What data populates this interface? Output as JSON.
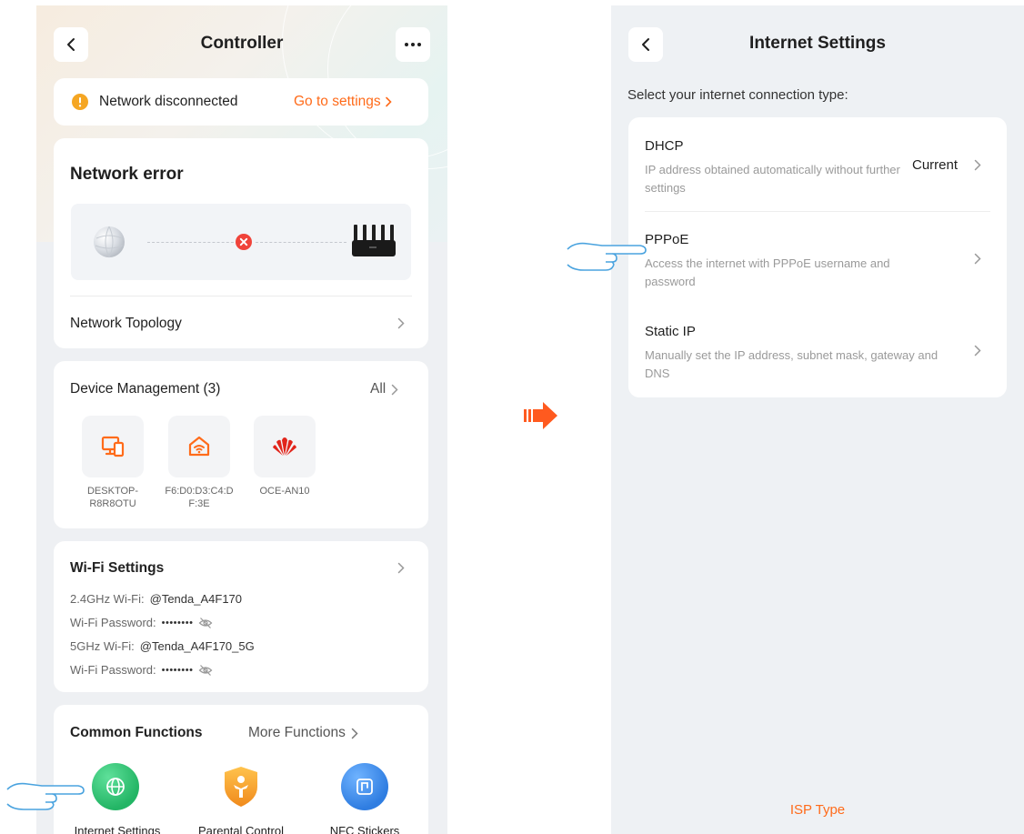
{
  "controller": {
    "title": "Controller",
    "banner": {
      "text": "Network disconnected",
      "link": "Go to settings"
    },
    "network_error": {
      "title": "Network error",
      "topology_label": "Network Topology"
    },
    "device_management": {
      "title": "Device Management (3)",
      "all_label": "All",
      "devices": [
        {
          "label": "DESKTOP-\nR8R8OTU",
          "icon": "computer-icon"
        },
        {
          "label": "F6:D0:D3:C4:D\nF:3E",
          "icon": "smart-home-wifi-icon"
        },
        {
          "label": "OCE-AN10",
          "icon": "huawei-logo"
        }
      ]
    },
    "wifi_settings": {
      "title": "Wi-Fi Settings",
      "rows": [
        {
          "label": "2.4GHz Wi-Fi:",
          "value": "@Tenda_A4F170"
        },
        {
          "label": "Wi-Fi Password:",
          "value": "••••••••"
        },
        {
          "label": "5GHz Wi-Fi:",
          "value": "@Tenda_A4F170_5G"
        },
        {
          "label": "Wi-Fi Password:",
          "value": "••••••••"
        }
      ]
    },
    "common_functions": {
      "title": "Common Functions",
      "more_label": "More Functions",
      "items": [
        {
          "label": "Internet Settings",
          "icon": "globe-icon",
          "color": "#2fbf71"
        },
        {
          "label": "Parental Control",
          "icon": "child-shield-icon",
          "color": "#f5a623"
        },
        {
          "label": "NFC Stickers",
          "icon": "nfc-icon",
          "color": "#2f7de1"
        }
      ]
    }
  },
  "internet_settings": {
    "title": "Internet Settings",
    "prompt": "Select your internet connection type:",
    "options": [
      {
        "title": "DHCP",
        "desc": "IP address obtained automatically without further settings",
        "status": "Current"
      },
      {
        "title": "PPPoE",
        "desc": "Access the internet with PPPoE username and password",
        "status": ""
      },
      {
        "title": "Static IP",
        "desc": "Manually set the IP address, subnet mask, gateway and DNS",
        "status": ""
      }
    ],
    "footer_link": "ISP Type"
  },
  "colors": {
    "accent": "#ff6b1a",
    "error": "#f0433a",
    "warning": "#f5a623"
  }
}
